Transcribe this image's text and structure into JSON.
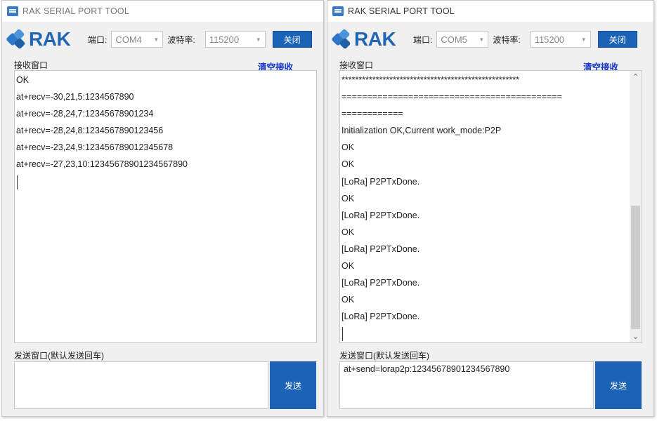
{
  "left": {
    "title": "RAK SERIAL PORT TOOL",
    "logo_text": "RAK",
    "port_label": "端口:",
    "port_value": "COM4",
    "baud_label": "波特率:",
    "baud_value": "115200",
    "close_label": "关闭",
    "recv_label": "接收窗口",
    "clear_label": "清空接收",
    "recv_lines": [
      "OK",
      "at+recv=-30,21,5:1234567890",
      "at+recv=-28,24,7:12345678901234",
      "at+recv=-28,24,8:1234567890123456",
      "at+recv=-23,24,9:123456789012345678",
      "at+recv=-27,23,10:12345678901234567890"
    ],
    "send_label": "发送窗口(默认发送回车)",
    "send_value": "",
    "send_button": "发送"
  },
  "right": {
    "title": "RAK SERIAL PORT TOOL",
    "logo_text": "RAK",
    "port_label": "端口:",
    "port_value": "COM5",
    "baud_label": "波特率:",
    "baud_value": "115200",
    "close_label": "关闭",
    "recv_label": "接收窗口",
    "clear_label": "清空接收",
    "recv_lines": [
      "****************************************************",
      "===========================================",
      "============",
      "Initialization OK,Current work_mode:P2P",
      "OK",
      "OK",
      "[LoRa] P2PTxDone.",
      "OK",
      "[LoRa] P2PTxDone.",
      "OK",
      "[LoRa] P2PTxDone.",
      "OK",
      "[LoRa] P2PTxDone.",
      "OK",
      "[LoRa] P2PTxDone."
    ],
    "send_label": "发送窗口(默认发送回车)",
    "send_value": "at+send=lorap2p:12345678901234567890",
    "send_button": "发送",
    "scroll_up_icon": "chevron-up-icon",
    "scroll_down_icon": "chevron-down-icon"
  },
  "colors": {
    "accent": "#1c63b8",
    "link": "#1436c8",
    "logo": "#2166b5"
  }
}
